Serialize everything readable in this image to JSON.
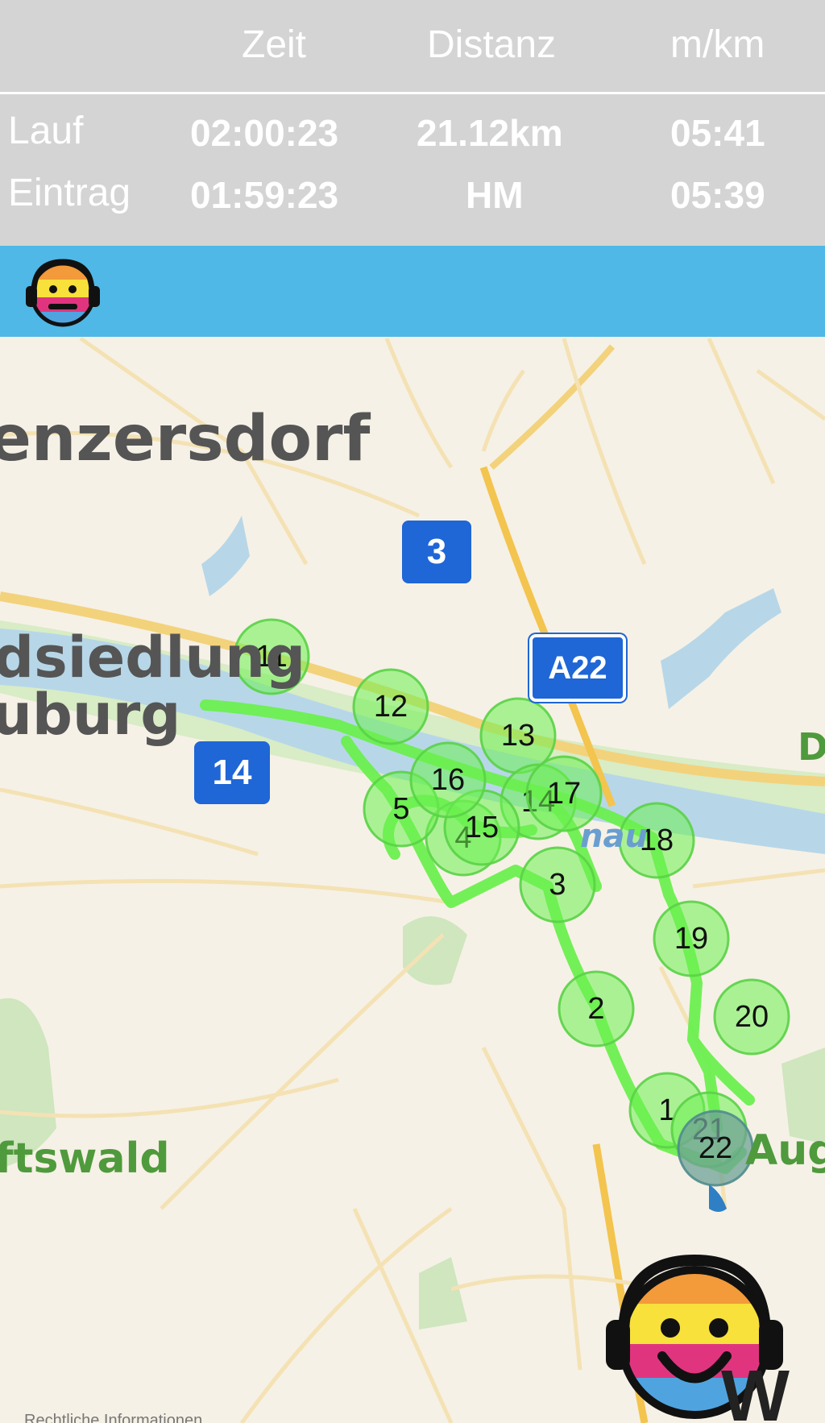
{
  "stats": {
    "headers": [
      "Zeit",
      "Distanz",
      "m/km"
    ],
    "rows": [
      {
        "label": "Lauf",
        "zeit": "02:00:23",
        "distanz": "21.12km",
        "pace": "05:41"
      },
      {
        "label": "Eintrag",
        "zeit": "01:59:23",
        "distanz": "HM",
        "pace": "05:39"
      }
    ]
  },
  "header_bar": {
    "color": "#4fb8e6",
    "icon": "headphone-smiley-icon"
  },
  "map": {
    "place_labels": [
      "enzersdorf",
      "dsiedlung",
      "uburg",
      "ftswald",
      "Aug",
      "D",
      "nau"
    ],
    "road_signs": [
      "3",
      "A22",
      "14"
    ],
    "route_color": "#6cf050",
    "km_markers": [
      "1",
      "2",
      "3",
      "4",
      "5",
      "11",
      "12",
      "13",
      "14",
      "15",
      "16",
      "17",
      "18",
      "19",
      "20",
      "21",
      "22"
    ],
    "attribution": "Rechtliche Informationen"
  },
  "colors": {
    "water": "#b7d7e8",
    "land": "#f6f1e6",
    "park": "#cfe6bf",
    "road": "#f3d27c",
    "accent": "#4fb8e6"
  },
  "logo": {
    "icon": "headphone-smiley-icon"
  },
  "corner_text": "W"
}
